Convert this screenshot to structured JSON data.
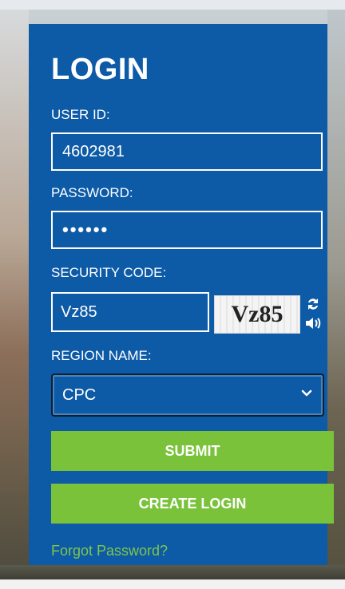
{
  "login": {
    "title": "LOGIN",
    "user_id_label": "USER ID:",
    "user_id_value": "4602981",
    "password_label": "PASSWORD:",
    "password_value_masked": "••••••",
    "security_code_label": "SECURITY CODE:",
    "security_code_value": "Vz85",
    "captcha_text": "Vz85",
    "region_label": "REGION NAME:",
    "region_selected": "CPC",
    "submit_label": "SUBMIT",
    "create_login_label": "CREATE LOGIN",
    "forgot_password_label": "Forgot Password?"
  },
  "colors": {
    "panel": "#0d5aa7",
    "button": "#79c23a",
    "link": "#7fc64a"
  },
  "icons": [
    "refresh-icon",
    "audio-icon",
    "chevron-down-icon"
  ]
}
